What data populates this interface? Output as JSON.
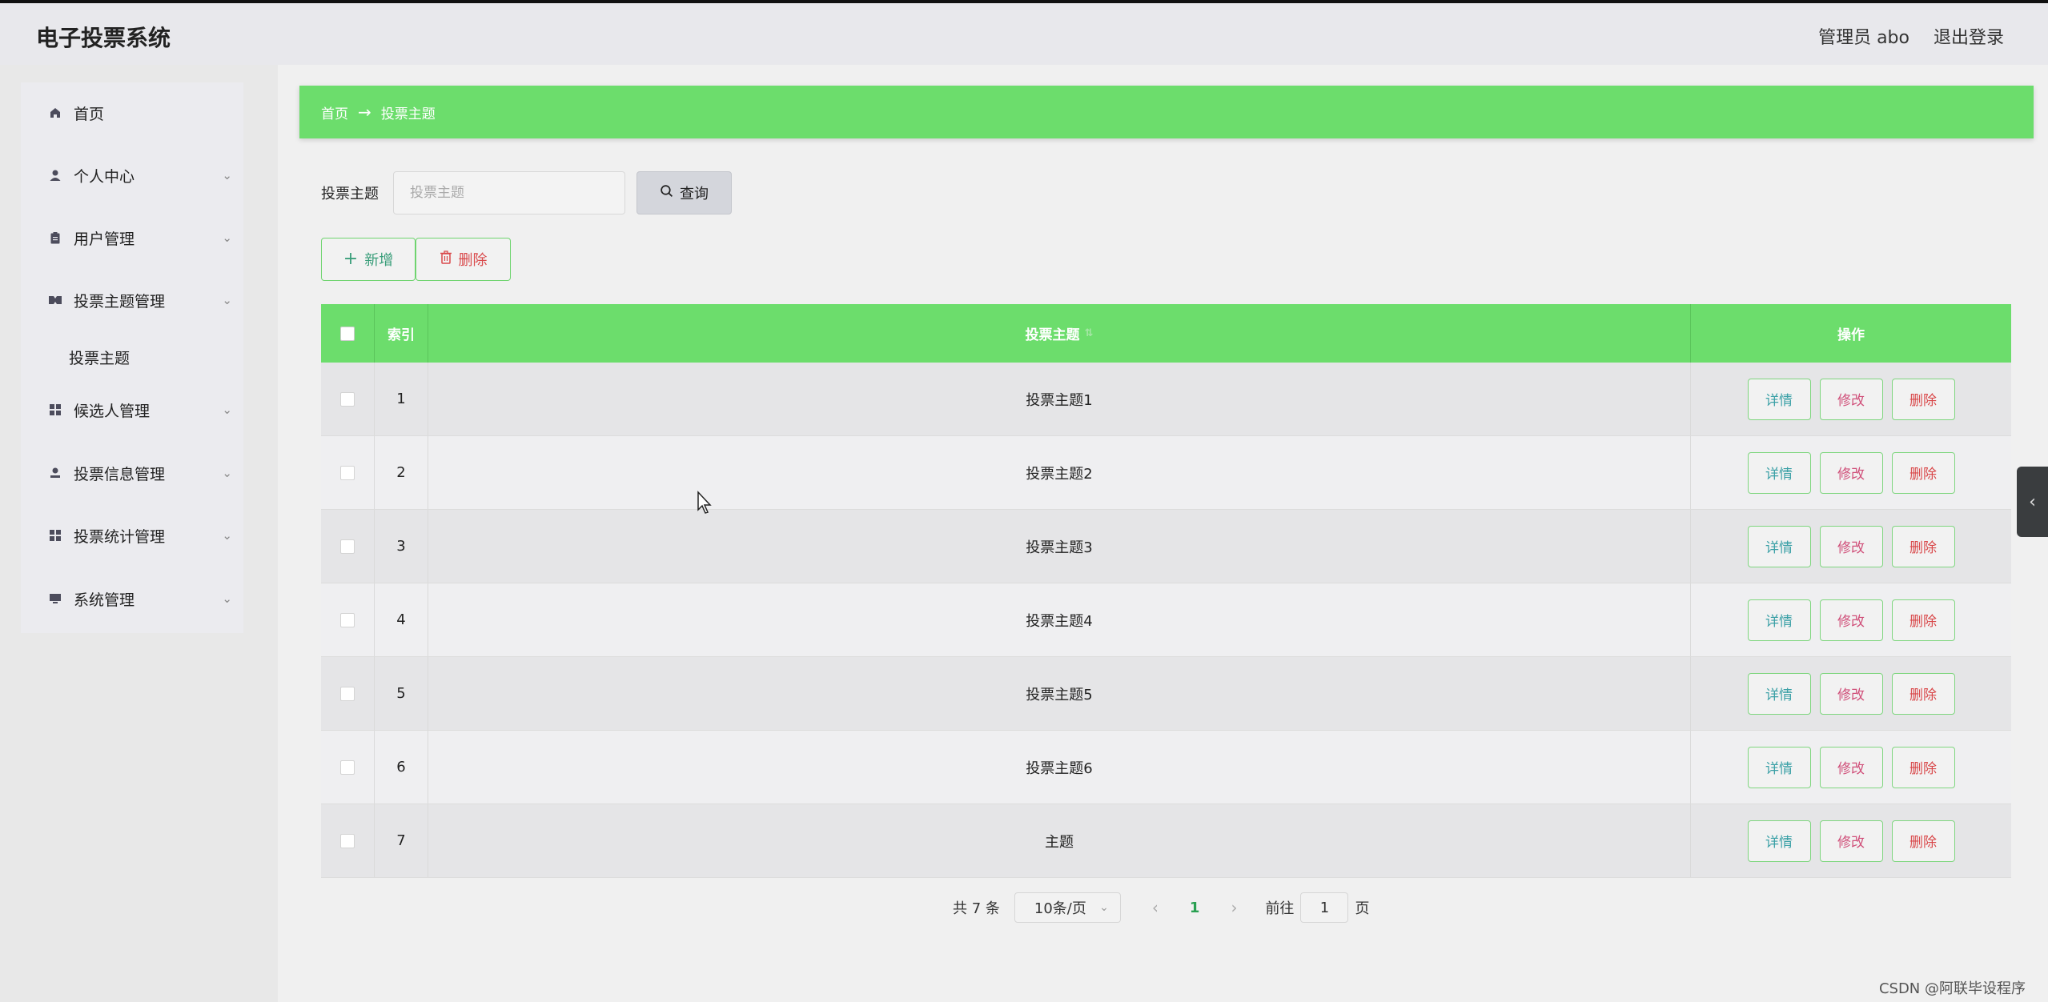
{
  "app": {
    "title": "电子投票系统"
  },
  "header": {
    "user_label": "管理员 abo",
    "logout_label": "退出登录"
  },
  "sidebar": {
    "items": [
      {
        "label": "首页",
        "icon": "home-icon"
      },
      {
        "label": "个人中心",
        "icon": "user-icon"
      },
      {
        "label": "用户管理",
        "icon": "clipboard-icon"
      },
      {
        "label": "投票主题管理",
        "icon": "ticket-icon"
      },
      {
        "label": "候选人管理",
        "icon": "grid-icon"
      },
      {
        "label": "投票信息管理",
        "icon": "person-icon"
      },
      {
        "label": "投票统计管理",
        "icon": "grid-icon"
      },
      {
        "label": "系统管理",
        "icon": "monitor-icon"
      }
    ],
    "sub_item": "投票主题"
  },
  "breadcrumb": {
    "home": "首页",
    "arrow": "→",
    "current": "投票主题"
  },
  "search": {
    "label": "投票主题",
    "placeholder": "投票主题",
    "button": "查询"
  },
  "toolbar": {
    "add_label": "新增",
    "delete_label": "删除"
  },
  "table": {
    "headers": {
      "index": "索引",
      "topic": "投票主题",
      "ops": "操作"
    },
    "rows": [
      {
        "index": "1",
        "topic": "投票主题1"
      },
      {
        "index": "2",
        "topic": "投票主题2"
      },
      {
        "index": "3",
        "topic": "投票主题3"
      },
      {
        "index": "4",
        "topic": "投票主题4"
      },
      {
        "index": "5",
        "topic": "投票主题5"
      },
      {
        "index": "6",
        "topic": "投票主题6"
      },
      {
        "index": "7",
        "topic": "主题"
      }
    ],
    "row_actions": {
      "detail": "详情",
      "edit": "修改",
      "delete": "删除"
    }
  },
  "pagination": {
    "total": "共 7 条",
    "page_size": "10条/页",
    "current_page": "1",
    "goto_label": "前往",
    "goto_value": "1",
    "page_suffix": "页"
  },
  "watermark": "CSDN @阿联毕设程序",
  "colors": {
    "accent_green": "#6cdd6c",
    "delete_red": "#d9484a",
    "edit_pink": "#d0507a",
    "detail_teal": "#3aa0a6"
  }
}
